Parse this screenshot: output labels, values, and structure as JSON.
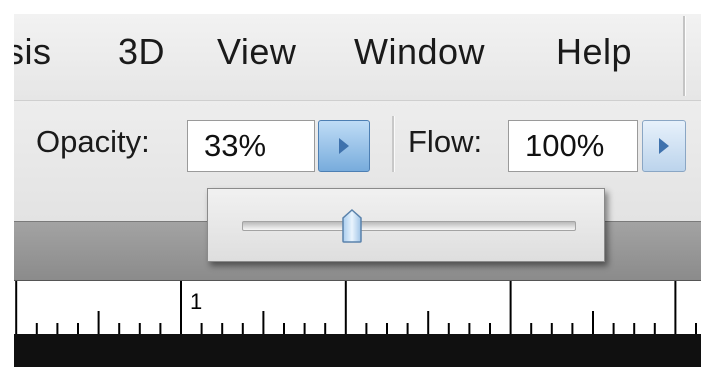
{
  "menu": {
    "items": [
      "sis",
      "3D",
      "View",
      "Window",
      "Help"
    ]
  },
  "options_bar": {
    "opacity_label": "Opacity:",
    "opacity_value": "33%",
    "flow_label": "Flow:",
    "flow_value": "100%"
  },
  "opacity_popup": {
    "slider_value": 0.33
  },
  "ruler": {
    "label": "1"
  },
  "icons": {
    "opacity_arrow": "triangle-right-icon",
    "flow_arrow": "triangle-right-icon"
  },
  "colors": {
    "accent": "#3f72ad"
  }
}
